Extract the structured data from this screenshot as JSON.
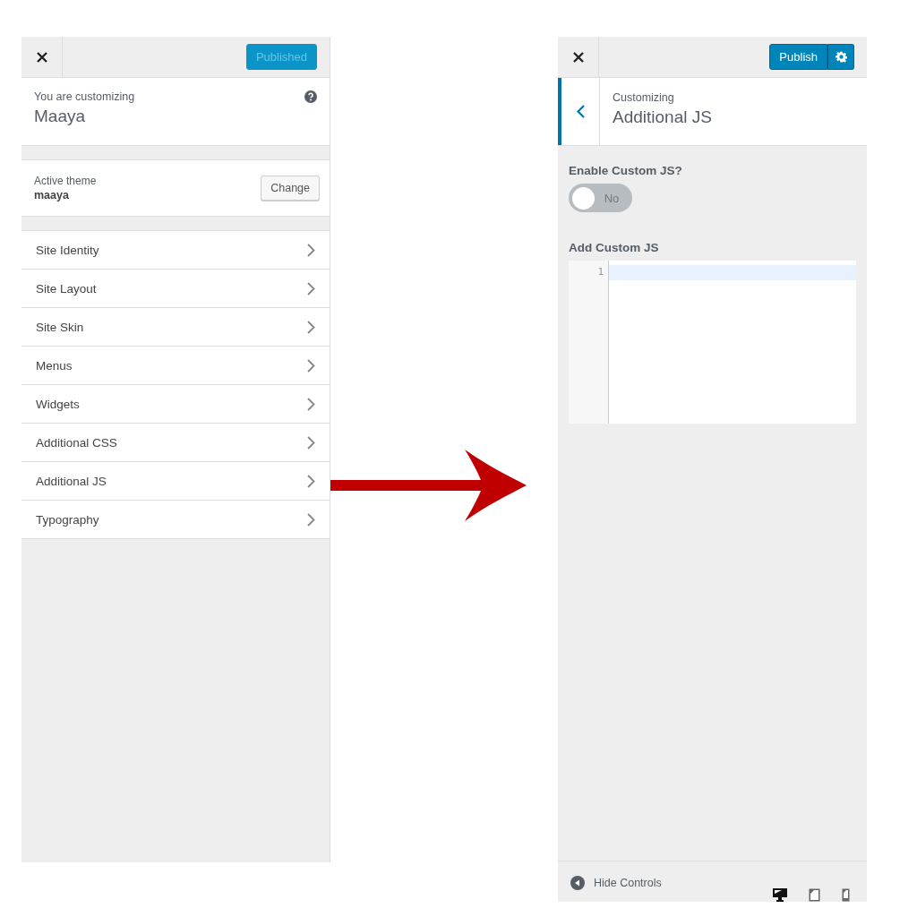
{
  "left_panel": {
    "publish_button": {
      "label": "Published",
      "disabled": true
    },
    "info": {
      "caption": "You are customizing",
      "title": "Maaya"
    },
    "theme": {
      "caption": "Active theme",
      "name": "maaya",
      "button": "Change"
    },
    "sections": [
      {
        "label": "Site Identity"
      },
      {
        "label": "Site Layout"
      },
      {
        "label": "Site Skin"
      },
      {
        "label": "Menus"
      },
      {
        "label": "Widgets"
      },
      {
        "label": "Additional CSS"
      },
      {
        "label": "Additional JS"
      },
      {
        "label": "Typography"
      }
    ]
  },
  "right_panel": {
    "publish_button": {
      "label": "Publish",
      "disabled": false
    },
    "header": {
      "caption": "Customizing",
      "title": "Additional JS"
    },
    "toggle": {
      "label": "Enable Custom JS?",
      "on": false,
      "text": "No"
    },
    "editor": {
      "label": "Add Custom JS",
      "line_numbers": [
        "1"
      ]
    },
    "footer": {
      "label": "Hide Controls",
      "devices": [
        {
          "kind": "desktop",
          "selected": true
        },
        {
          "kind": "tablet",
          "selected": false
        },
        {
          "kind": "mobile",
          "selected": false
        }
      ]
    }
  }
}
